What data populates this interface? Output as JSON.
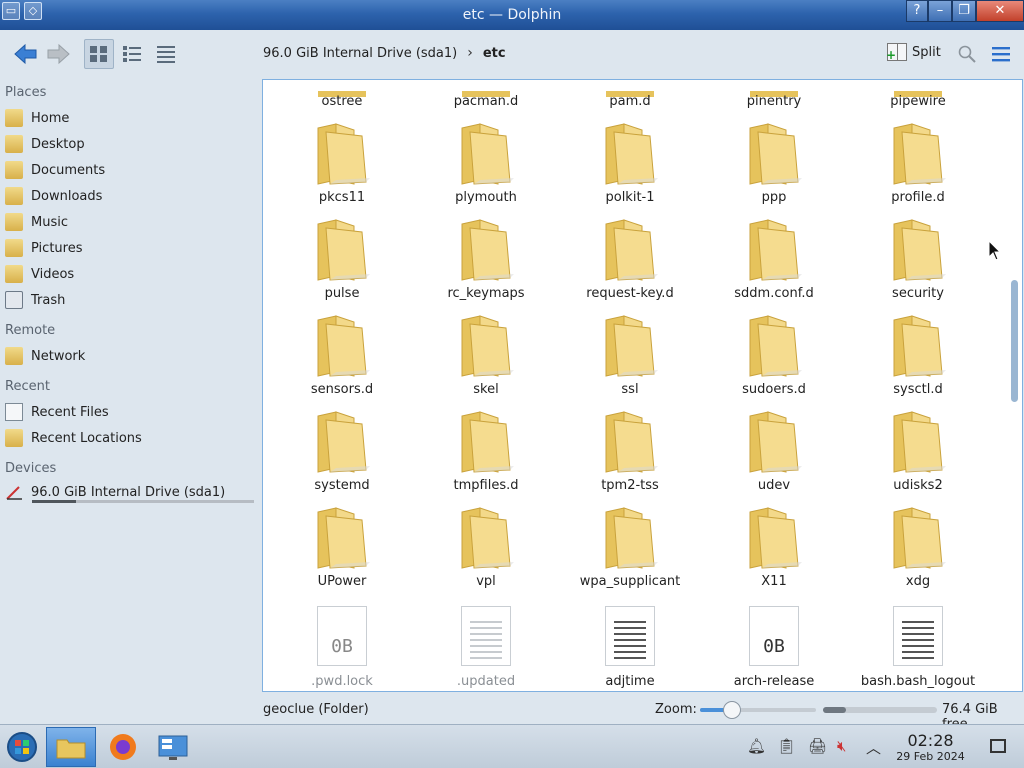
{
  "window": {
    "title": "etc — Dolphin"
  },
  "toolbar": {
    "breadcrumb": [
      "96.0 GiB Internal Drive (sda1)",
      "etc"
    ],
    "split_label": "Split"
  },
  "sidebar": {
    "places_heading": "Places",
    "places": [
      "Home",
      "Desktop",
      "Documents",
      "Downloads",
      "Music",
      "Pictures",
      "Videos",
      "Trash"
    ],
    "remote_heading": "Remote",
    "remote": [
      "Network"
    ],
    "recent_heading": "Recent",
    "recent": [
      "Recent Files",
      "Recent Locations"
    ],
    "devices_heading": "Devices",
    "devices": [
      "96.0 GiB Internal Drive (sda1)"
    ],
    "drive_usage_fraction": 0.2
  },
  "files": {
    "partial_row": [
      "ostree",
      "pacman.d",
      "pam.d",
      "pinentry",
      "pipewire"
    ],
    "rows": [
      [
        "pkcs11",
        "plymouth",
        "polkit-1",
        "ppp",
        "profile.d"
      ],
      [
        "pulse",
        "rc_keymaps",
        "request-key.d",
        "sddm.conf.d",
        "security"
      ],
      [
        "sensors.d",
        "skel",
        "ssl",
        "sudoers.d",
        "sysctl.d"
      ],
      [
        "systemd",
        "tmpfiles.d",
        "tpm2-tss",
        "udev",
        "udisks2"
      ],
      [
        "UPower",
        "vpl",
        "wpa_supplicant",
        "X11",
        "xdg"
      ]
    ],
    "last_row": [
      {
        "name": ".pwd.lock",
        "kind": "empty",
        "badge": "0B",
        "hidden": true
      },
      {
        "name": ".updated",
        "kind": "text",
        "hidden": true
      },
      {
        "name": "adjtime",
        "kind": "text",
        "hidden": false
      },
      {
        "name": "arch-release",
        "kind": "empty",
        "badge": "0B",
        "hidden": false
      },
      {
        "name": "bash.bash_logout",
        "kind": "text",
        "hidden": false
      }
    ]
  },
  "statusbar": {
    "selection_text": "geoclue (Folder)",
    "zoom_label": "Zoom:",
    "zoom_fraction": 0.28,
    "free_space_text": "76.4 GiB free",
    "disk_used_fraction": 0.2
  },
  "taskbar": {
    "time": "02:28",
    "date": "29 Feb 2024"
  },
  "colors": {
    "accent": "#3b82d0",
    "folder": "#e8c65e",
    "background": "#dde6ee"
  }
}
